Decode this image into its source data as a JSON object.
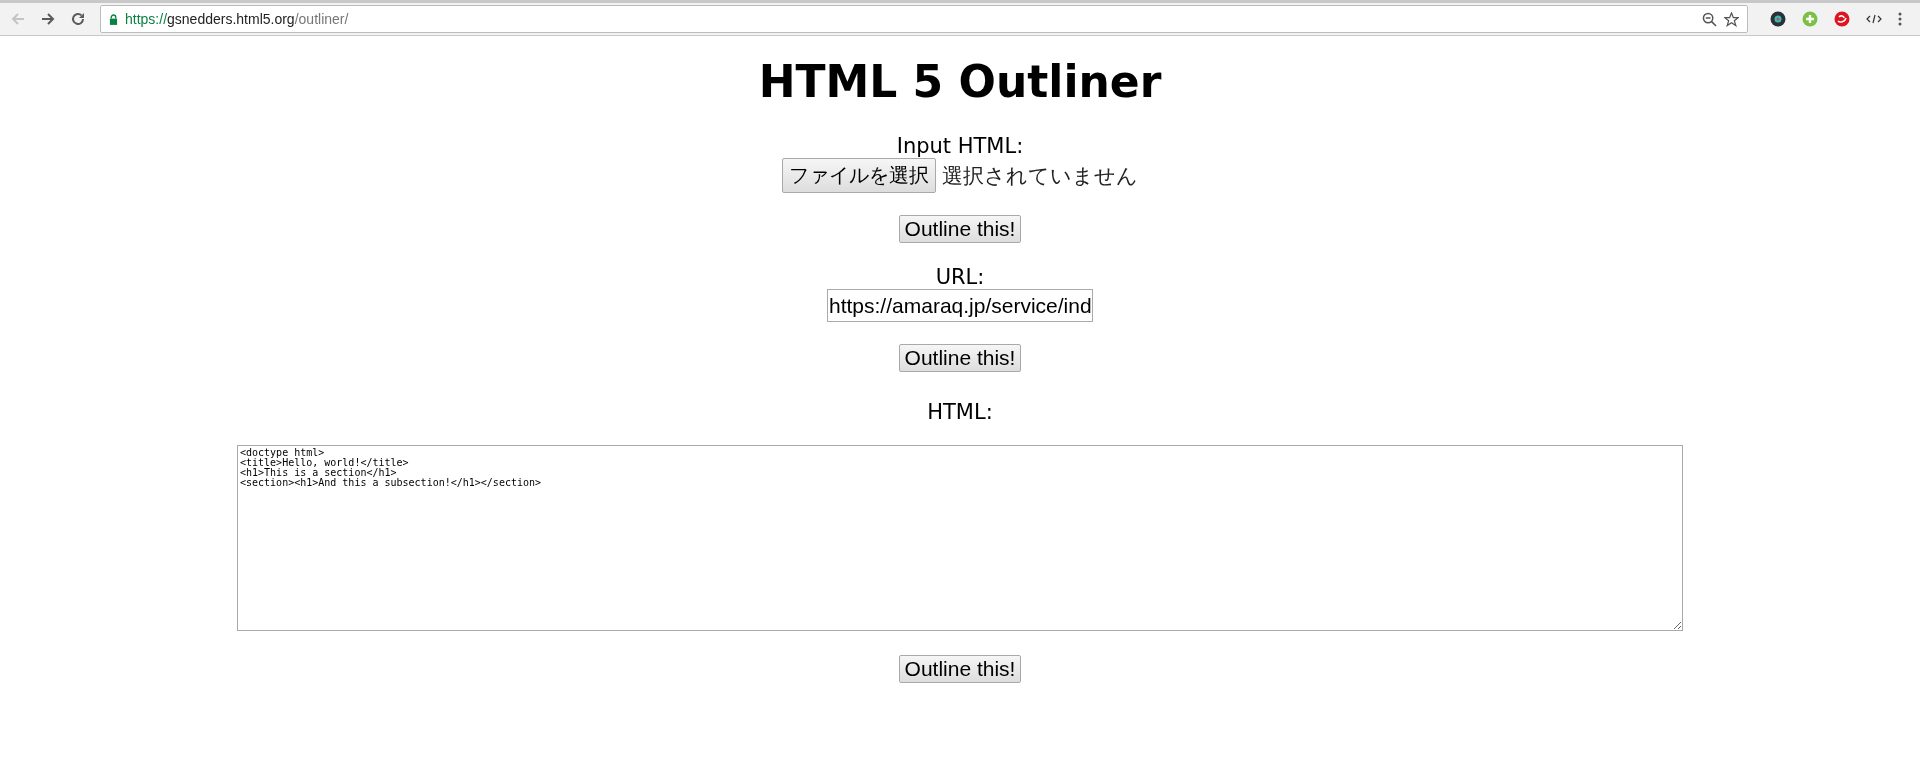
{
  "browser": {
    "nav_buttons": [
      {
        "kind": "back",
        "disabled": true
      },
      {
        "kind": "forward",
        "disabled": false
      },
      {
        "kind": "reload",
        "disabled": false
      }
    ],
    "address": {
      "secure": true,
      "scheme": "https://",
      "host": "gsnedders.html5.org",
      "path": "/outliner/"
    }
  },
  "page": {
    "title": "HTML 5 Outliner",
    "file_section": {
      "label": "Input HTML:",
      "choose_button": "ファイルを選択",
      "status": "選択されていません",
      "submit": "Outline this!"
    },
    "url_section": {
      "label": "URL:",
      "value": "https://amaraq.jp/service/ind",
      "submit": "Outline this!"
    },
    "html_section": {
      "label": "HTML:",
      "value": "<doctype html>\n<title>Hello, world!</title>\n<h1>This is a section</h1>\n<section><h1>And this a subsection!</h1></section>",
      "submit": "Outline this!"
    }
  }
}
